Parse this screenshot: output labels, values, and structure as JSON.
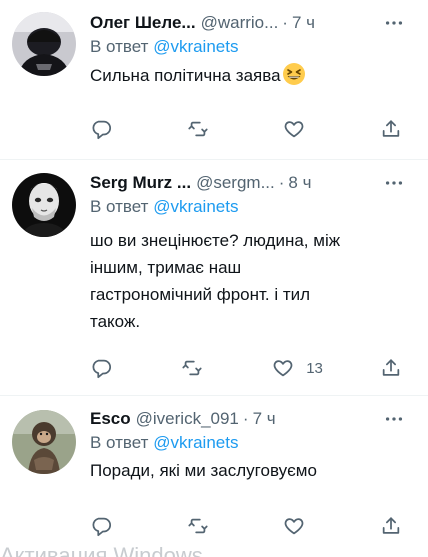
{
  "tweets": [
    {
      "name": "Олег Шеле...",
      "handle": "@warrio...",
      "separator": "·",
      "time": "7 ч",
      "reply_prefix": "В ответ",
      "reply_to": "@vkrainets",
      "text_lines": [
        "Сильна політична заява"
      ],
      "emoji": "grinning-squinting-face",
      "actions": {
        "reply": "",
        "retweet": "",
        "like": "",
        "share": ""
      }
    },
    {
      "name": "Serg Murz ...",
      "handle": "@sergm...",
      "separator": "·",
      "time": "8 ч",
      "reply_prefix": "В ответ",
      "reply_to": "@vkrainets",
      "text_lines": [
        "шо ви знецінюєте? людина, між",
        "іншим, тримає наш",
        "гастрономічний фронт. і тил",
        "також."
      ],
      "actions": {
        "reply": "",
        "retweet": "",
        "like": "13",
        "share": ""
      }
    },
    {
      "name": "Esco",
      "handle": "@iverick_091",
      "separator": "·",
      "time": "7 ч",
      "reply_prefix": "В ответ",
      "reply_to": "@vkrainets",
      "text_lines": [
        "Поради, які ми заслуговуємо"
      ],
      "actions": {
        "reply": "",
        "retweet": "",
        "like": "",
        "share": ""
      }
    }
  ],
  "watermark": "Активация Windows",
  "colors": {
    "accent": "#1d9bf0",
    "secondary_text": "#536471",
    "primary_text": "#0f1419",
    "divider": "#eff3f4"
  }
}
